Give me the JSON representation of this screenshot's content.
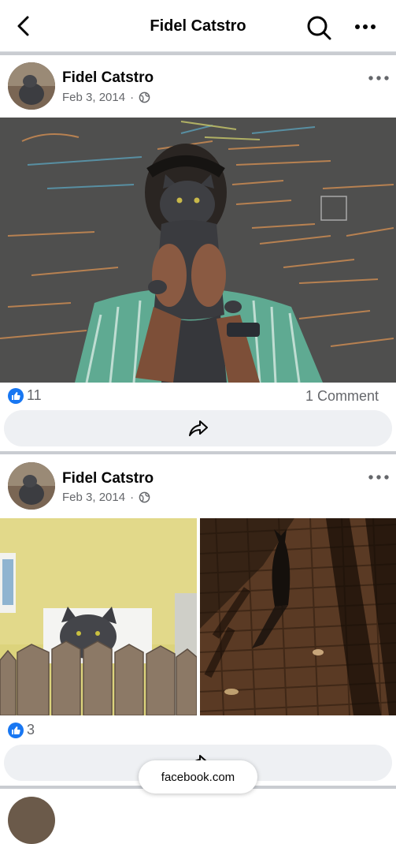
{
  "header": {
    "title": "Fidel Catstro",
    "icons": {
      "back": "chevron-left-icon",
      "search": "search-icon",
      "more": "more-horizontal-icon"
    }
  },
  "posts": [
    {
      "author": "Fidel Catstro",
      "date": "Feb 3, 2014",
      "separator": "·",
      "audience_icon": "globe-icon",
      "media": [
        "Man holding a gray cat in front of a chalkboard"
      ],
      "reactions": "11",
      "comments": "1 Comment"
    },
    {
      "author": "Fidel Catstro",
      "date": "Feb 3, 2014",
      "separator": "·",
      "audience_icon": "globe-icon",
      "media": [
        "Gray cat peeking over a wooden fence",
        "Cat silhouette on brick pavement"
      ],
      "reactions": "3"
    }
  ],
  "browser": {
    "domain": "facebook.com"
  },
  "colors": {
    "like_blue": "#1877f2",
    "separator": "#c9ccd1",
    "muted_text": "#65676b",
    "button_bg": "#eef0f3"
  }
}
